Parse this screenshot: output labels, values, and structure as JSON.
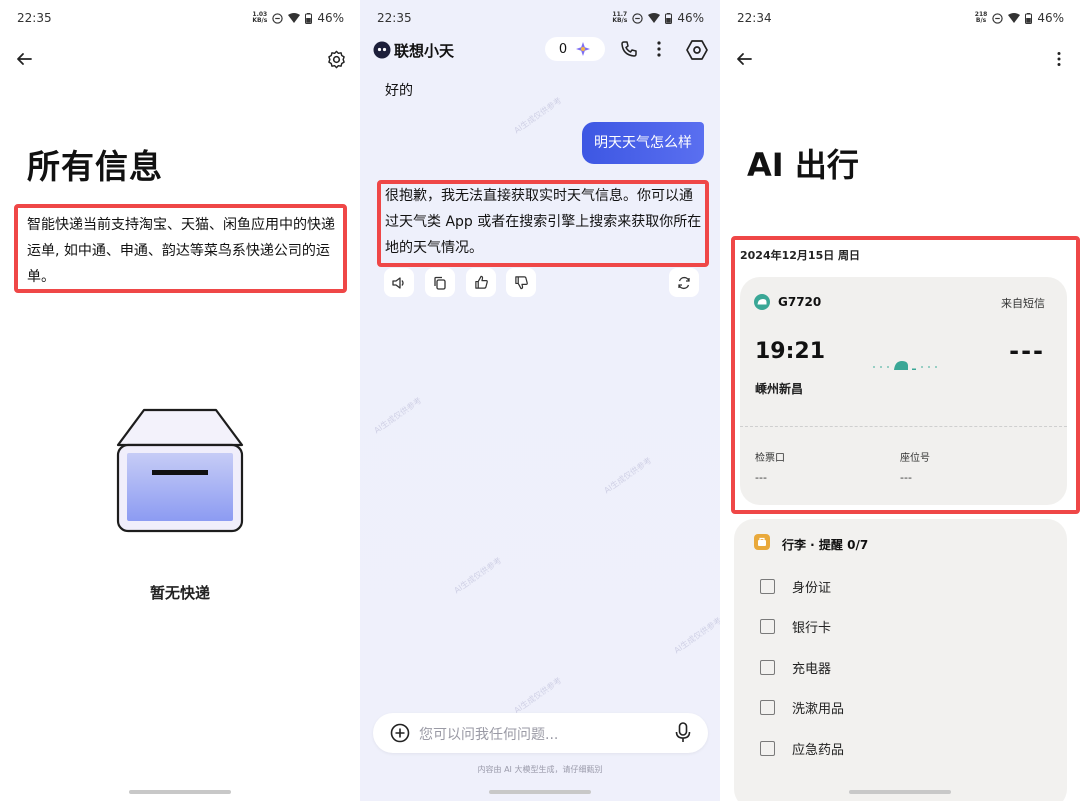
{
  "screen1": {
    "status": {
      "time": "22:35",
      "net_top": "1.03",
      "net_bottom": "KB/s",
      "battery": "46%"
    },
    "title": "所有信息",
    "info_text": "智能快递当前支持淘宝、天猫、闲鱼应用中的快递运单, 如中通、申通、韵达等菜鸟系快递公司的运单。",
    "empty_text": "暂无快递"
  },
  "screen2": {
    "status": {
      "time": "22:35",
      "net_top": "11.7",
      "net_bottom": "KB/s",
      "battery": "46%"
    },
    "app_title": "联想小天",
    "chip_count": "0",
    "prev_reply": "好的",
    "user_message": "明天天气怎么样",
    "reply_text": "很抱歉，我无法直接获取实时天气信息。你可以通过天气类 App 或者在搜索引擎上搜索来获取你所在地的天气情况。",
    "input_placeholder": "您可以问我任何问题...",
    "disclaimer": "内容由 AI 大模型生成，请仔细甄别",
    "accent_color": "#4a61ea"
  },
  "screen3": {
    "status": {
      "time": "22:34",
      "net_top": "218",
      "net_bottom": "B/s",
      "battery": "46%"
    },
    "title": "AI 出行",
    "date": "2024年12月15日 周日",
    "ticket": {
      "train": "G7720",
      "source": "来自短信",
      "departure_time": "19:21",
      "arrival_time": "---",
      "departure_station": "嵊州新昌",
      "gate_label": "检票口",
      "gate_value": "---",
      "seat_label": "座位号",
      "seat_value": "---",
      "brand_color": "#3aa796"
    },
    "luggage": {
      "header": "行李 · 提醒  0/7",
      "items": [
        "身份证",
        "银行卡",
        "充电器",
        "洗漱用品",
        "应急药品"
      ],
      "icon_color": "#e9a93b"
    }
  },
  "highlight_color": "#ef4747"
}
